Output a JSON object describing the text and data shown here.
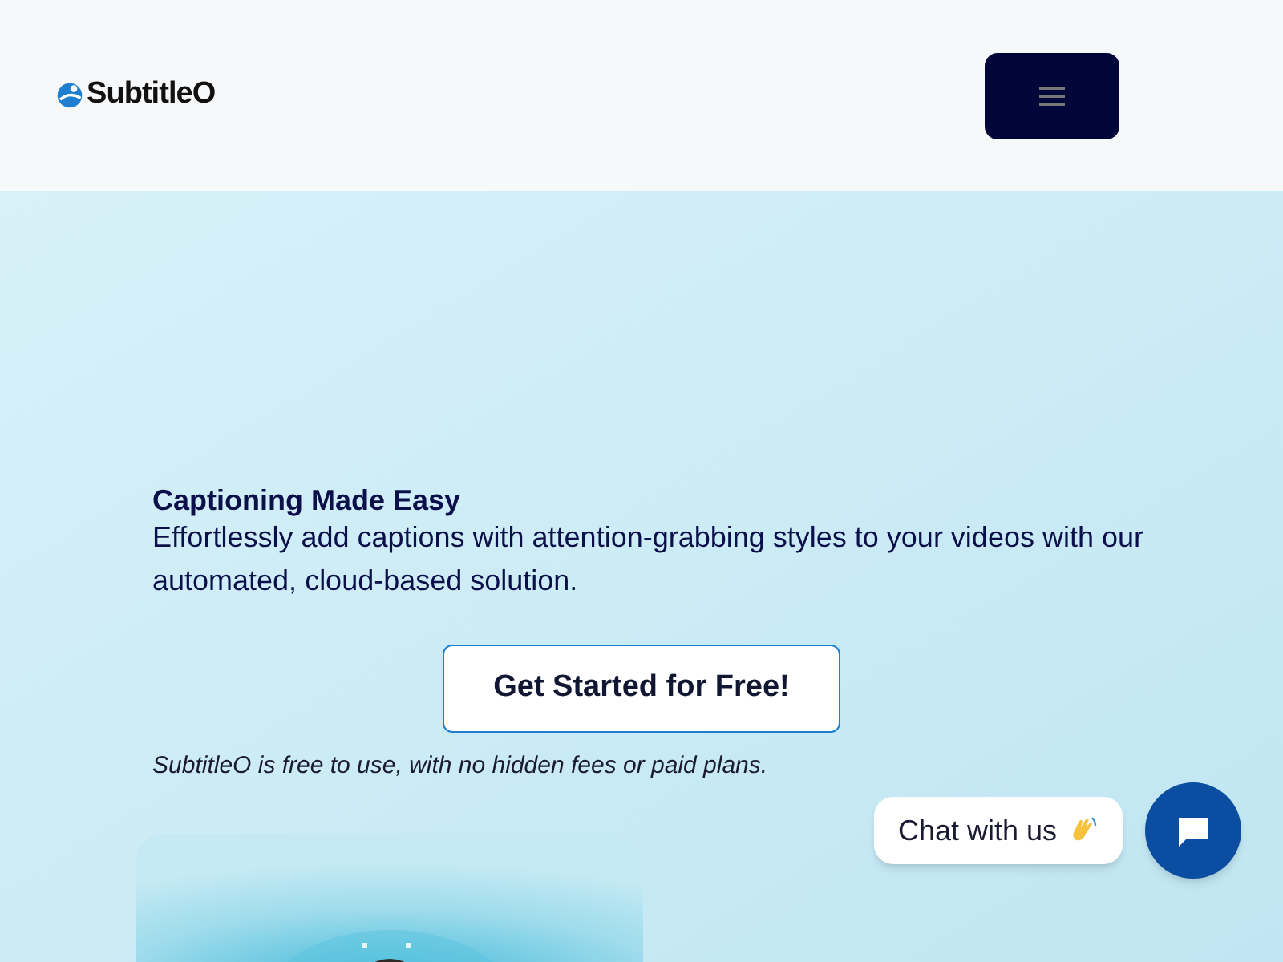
{
  "header": {
    "logo_text": "SubtitleO"
  },
  "hero": {
    "title": "Captioning Made Easy",
    "subtitle": "Effortlessly add captions with attention-grabbing styles to your videos with our automated, cloud-based solution.",
    "cta": "Get Started for Free!",
    "note": "SubtitleO is free to use, with no hidden fees or paid plans."
  },
  "chat": {
    "label": "Chat with us"
  }
}
